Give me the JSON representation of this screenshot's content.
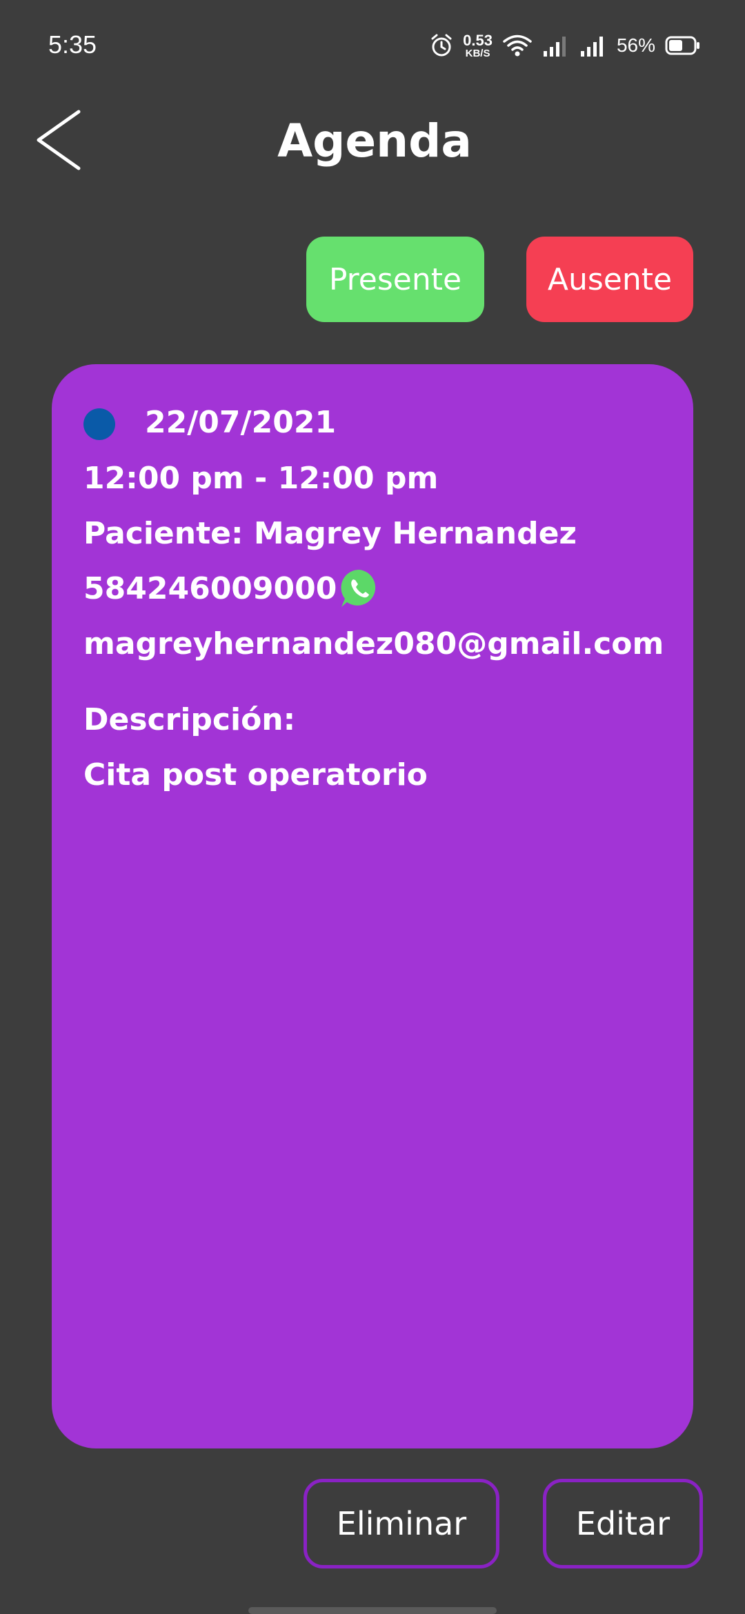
{
  "status_bar": {
    "time": "5:35",
    "net_speed_value": "0.53",
    "net_speed_unit": "KB/S",
    "battery_percent": "56%",
    "battery_level": 0.56,
    "icons": [
      "alarm-icon",
      "wifi-icon",
      "signal-icon",
      "signal-icon",
      "battery-icon"
    ]
  },
  "header": {
    "title": "Agenda",
    "back_icon": "chevron-left-icon"
  },
  "attendance": {
    "present_label": "Presente",
    "present_color": "#66e06e",
    "absent_label": "Ausente",
    "absent_color": "#f53f53"
  },
  "appointment": {
    "card_color": "#a234d6",
    "status_dot_color": "#0a5aa8",
    "date": "22/07/2021",
    "time_range": "12:00 pm - 12:00 pm",
    "patient": "Paciente: Magrey Hernandez",
    "phone": "584246009000",
    "phone_icon": "whatsapp-icon",
    "email": "magreyhernandez080@gmail.com",
    "description_label": "Descripción:",
    "description": "Cita post operatorio"
  },
  "actions": {
    "delete_label": "Eliminar",
    "edit_label": "Editar",
    "border_color": "#8a22c4"
  }
}
